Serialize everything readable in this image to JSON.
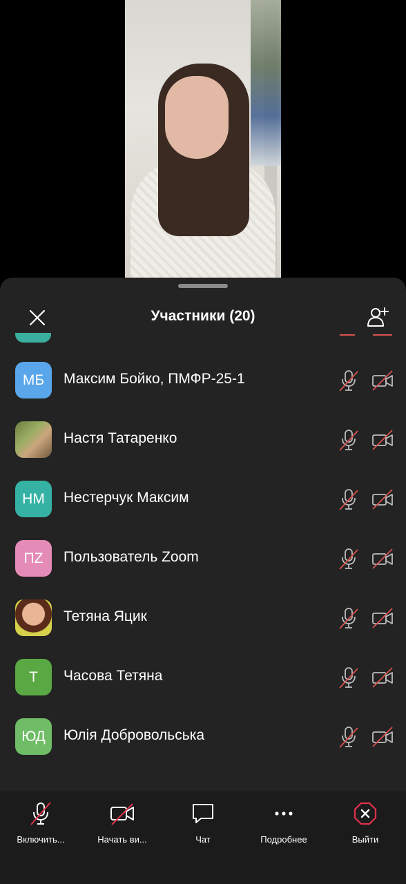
{
  "header": {
    "title": "Участники (20)"
  },
  "participants": [
    {
      "initials": "МБ",
      "name": "Максим Бойко, ПМФР-25-1",
      "color": "#5aa6ea",
      "photo": false
    },
    {
      "initials": "",
      "name": "Настя Татаренко",
      "color": "#7b8a4a",
      "photo": true
    },
    {
      "initials": "НМ",
      "name": "Нестерчук Максим",
      "color": "#35b2a4",
      "photo": false
    },
    {
      "initials": "ПZ",
      "name": "Пользователь Zoom",
      "color": "#e58bb8",
      "photo": false
    },
    {
      "initials": "",
      "name": "Тетяна Яцик",
      "color": "#c8c144",
      "photo": true
    },
    {
      "initials": "Т",
      "name": "Часова Тетяна",
      "color": "#59a843",
      "photo": false
    },
    {
      "initials": "ЮД",
      "name": "Юлія Добровольська",
      "color": "#6fbd66",
      "photo": false
    }
  ],
  "toolbar": {
    "unmute_label": "Включить...",
    "start_video_label": "Начать ви...",
    "chat_label": "Чат",
    "more_label": "Подробнее",
    "leave_label": "Выйти"
  },
  "colors": {
    "sheet_bg": "#232323",
    "toolbar_bg": "#1b1b1b",
    "muted_red": "#d9534f",
    "leave_red": "#e0314b"
  }
}
